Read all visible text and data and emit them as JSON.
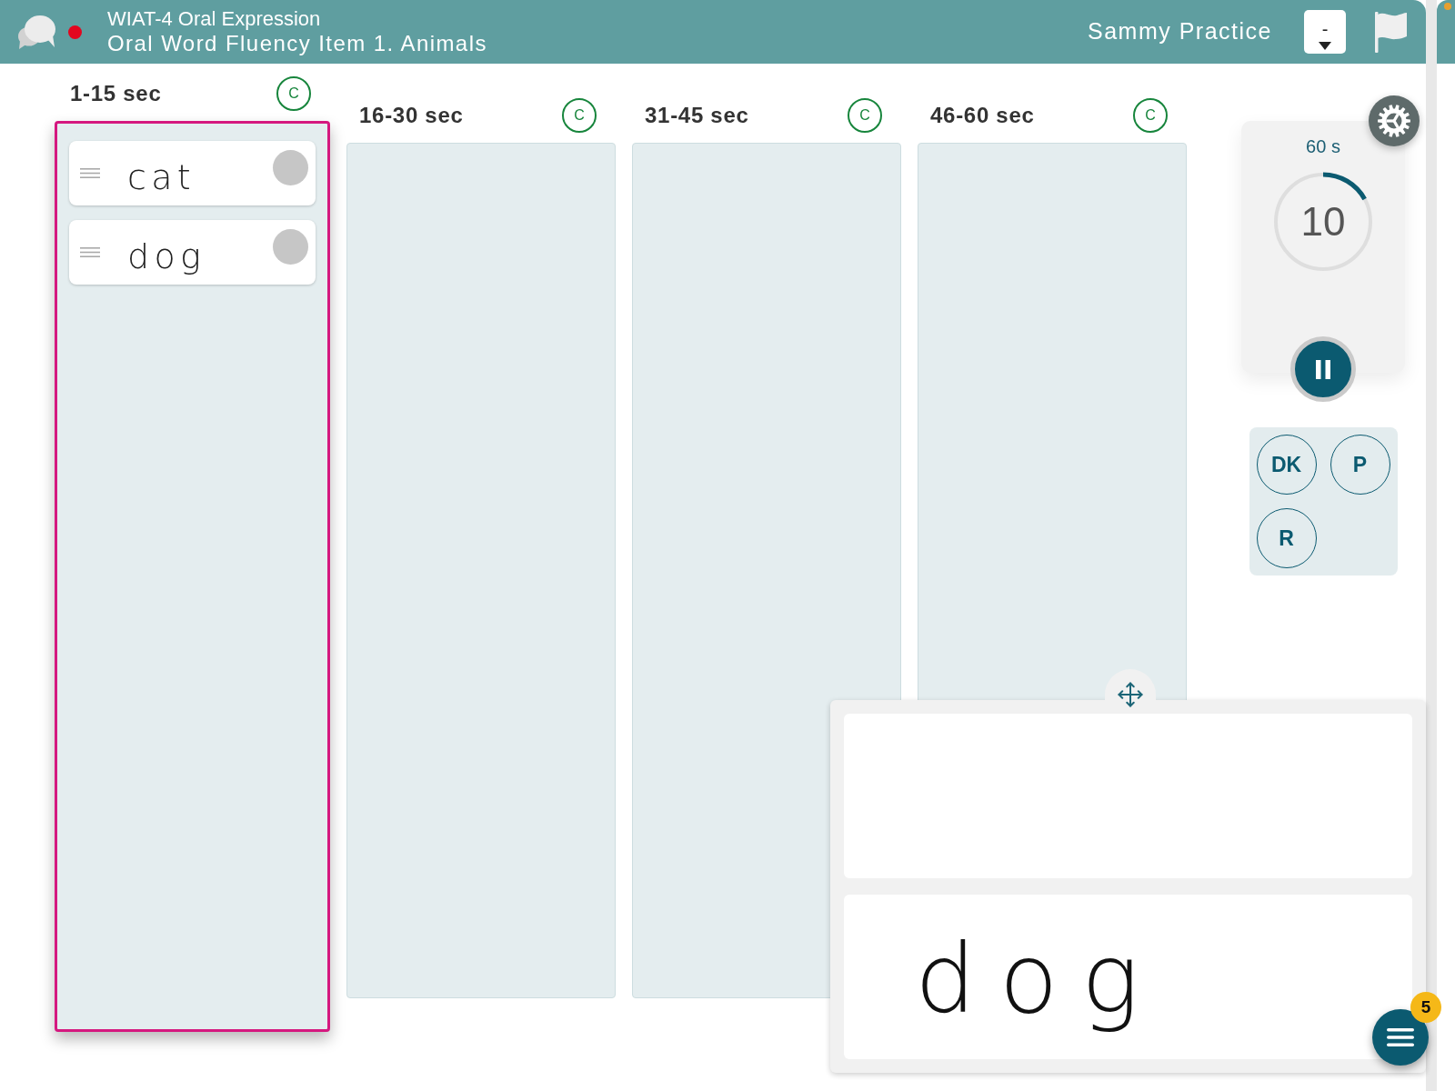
{
  "header": {
    "recording": true,
    "title": "WIAT-4 Oral Expression",
    "subtitle": "Oral Word Fluency Item 1. Animals",
    "examinee": "Sammy Practice",
    "dropdown": {
      "value": "-"
    }
  },
  "columns": [
    {
      "label": "1-15 sec",
      "button_label": "C",
      "selected": true,
      "responses": [
        {
          "text": "cat"
        },
        {
          "text": "dog"
        }
      ]
    },
    {
      "label": "16-30 sec",
      "button_label": "C",
      "selected": false
    },
    {
      "label": "31-45 sec",
      "button_label": "C",
      "selected": false
    },
    {
      "label": "46-60 sec",
      "button_label": "C",
      "selected": false
    }
  ],
  "timer": {
    "duration": "60 s",
    "remaining": "10",
    "level": 0.17,
    "running": true
  },
  "response_buttons": [
    {
      "label": "DK"
    },
    {
      "label": "P"
    },
    {
      "label": "R"
    }
  ],
  "writing_pad": {
    "ink": "dog"
  },
  "menu": {
    "badge": "5"
  }
}
